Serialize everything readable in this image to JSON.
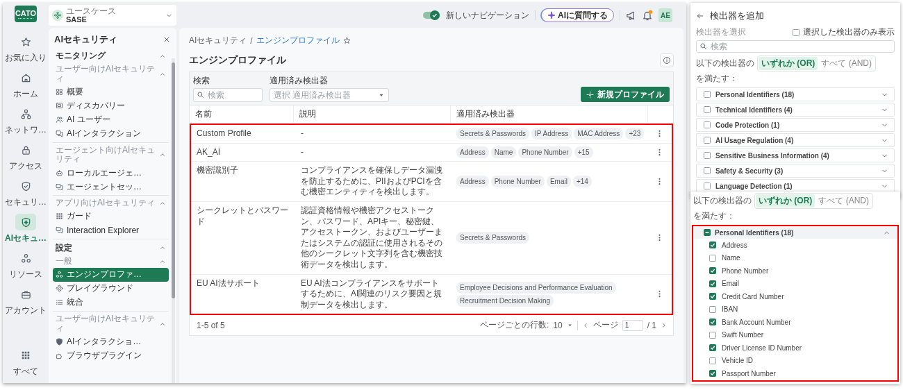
{
  "rail": {
    "logo": "CATO",
    "items": [
      {
        "label": "お気に入り",
        "selected": false
      },
      {
        "label": "ホーム",
        "selected": false
      },
      {
        "label": "ネットワ…",
        "selected": false
      },
      {
        "label": "アクセス",
        "selected": false
      },
      {
        "label": "セキュリ…",
        "selected": false
      },
      {
        "label": "AIセキュ…",
        "selected": true
      },
      {
        "label": "リソース",
        "selected": false
      },
      {
        "label": "アカウント",
        "selected": false
      }
    ],
    "all": "すべて"
  },
  "use_case": {
    "label": "ユースケース",
    "value": "SASE"
  },
  "topbar": {
    "nav_toggle": {
      "label": "新しいナビゲーション",
      "on": true
    },
    "ask_ai": "AIに質問する",
    "notification_badge": true,
    "avatar": "AE"
  },
  "sidebar": {
    "title": "AIセキュリティ",
    "sections": [
      {
        "title": "モニタリング",
        "expanded": true,
        "groups": [
          {
            "title": "ユーザー向けAIセキュリティ",
            "expanded": true,
            "items": [
              {
                "label": "概要",
                "selected": false
              },
              {
                "label": "ディスカバリー",
                "selected": false
              },
              {
                "label": "AI ユーザー",
                "selected": false
              },
              {
                "label": "AIインタラクション",
                "selected": false
              }
            ]
          },
          {
            "title": "エージェント向けAIセキュリティ",
            "expanded": true,
            "items": [
              {
                "label": "ローカルエージェ…",
                "selected": false
              },
              {
                "label": "エージェントセッ…",
                "selected": false
              }
            ]
          },
          {
            "title": "アプリ向けAIセキュリティ",
            "expanded": true,
            "items": [
              {
                "label": "ガード",
                "selected": false
              },
              {
                "label": "Interaction Explorer",
                "selected": false
              }
            ]
          }
        ]
      },
      {
        "title": "設定",
        "expanded": true,
        "groups": [
          {
            "title": "一般",
            "expanded": true,
            "items": [
              {
                "label": "エンジンプロファ…",
                "selected": true
              },
              {
                "label": "プレイグラウンド",
                "selected": false
              },
              {
                "label": "統合",
                "selected": false
              }
            ]
          },
          {
            "title": "ユーザー向けAIセキュリティ",
            "expanded": true,
            "items": [
              {
                "label": "AIインタラクショ…",
                "selected": false
              },
              {
                "label": "ブラウザプラグイン",
                "selected": false
              }
            ]
          }
        ]
      }
    ]
  },
  "breadcrumb": {
    "separator": "/",
    "items": [
      "AIセキュリティ",
      "エンジンプロファイル"
    ]
  },
  "page_title": "エンジンプロファイル",
  "filters": {
    "search": {
      "label": "検索",
      "placeholder": "検索"
    },
    "detectors": {
      "label": "適用済み検出器",
      "placeholder": "選択 適用済み検出器"
    },
    "new_button": "新規プロファイル"
  },
  "table": {
    "highlighted": true,
    "columns": [
      "名前",
      "説明",
      "適用済み検出器"
    ],
    "rows": [
      {
        "name": "Custom Profile",
        "description": "-",
        "detectors": [
          "Secrets & Passwords",
          "IP Address",
          "MAC Address",
          "+23"
        ]
      },
      {
        "name": "AK_AI",
        "description": "-",
        "detectors": [
          "Address",
          "Name",
          "Phone Number",
          "+15"
        ]
      },
      {
        "name": "機密識別子",
        "description": "コンプライアンスを確保しデータ漏洩を防止するために、PIIおよびPCIを含む機密エンティティを検出します。",
        "detectors": [
          "Address",
          "Phone Number",
          "Email",
          "+14"
        ]
      },
      {
        "name": "シークレットとパスワード",
        "description": "認証資格情報や機密アクセストークン、パスワード、APIキー、秘密鍵、アクセストークン、およびユーザーまたはシステムの認証に使用されるその他のシークレット文字列を含む機密技術データを検出します。",
        "detectors": [
          "Secrets & Passwords"
        ]
      },
      {
        "name": "EU AI法サポート",
        "description": "EU AI法コンプライアンスをサポートするために、AI関連のリスク要因と規制データを検出します。",
        "detectors": [
          "Employee Decisions and Performance Evaluation",
          "Recruitment Decision Making"
        ]
      }
    ]
  },
  "pagination": {
    "range": "1-5 of 5",
    "rows_per_page": {
      "label": "ページごとの行数:",
      "value": "10"
    },
    "page_label": "ページ",
    "page": "1",
    "total": "/ 1"
  },
  "add_detectors": {
    "title": "検出器を追加",
    "select_label": "検出器を選択",
    "show_selected_only": {
      "label": "選択した検出器のみ表示",
      "checked": false
    },
    "search": {
      "placeholder": "検索"
    },
    "match": {
      "prefix": "以下の検出器の",
      "options": [
        {
          "label": "いずれか (OR)",
          "selected": true
        },
        {
          "label": "すべて (AND)",
          "selected": false
        }
      ],
      "suffix": "を満たす："
    },
    "categories": [
      {
        "label": "Personal Identifiers (18)",
        "checked": false,
        "expanded": false
      },
      {
        "label": "Technical Identifiers (4)",
        "checked": false,
        "expanded": false
      },
      {
        "label": "Code Protection (1)",
        "checked": false,
        "expanded": false
      },
      {
        "label": "AI Usage Regulation (4)",
        "checked": false,
        "expanded": false
      },
      {
        "label": "Sensitive Business Information (4)",
        "checked": false,
        "expanded": false
      },
      {
        "label": "Safety & Security (3)",
        "checked": false,
        "expanded": false
      },
      {
        "label": "Language Detection (1)",
        "checked": false,
        "expanded": false
      }
    ]
  },
  "detector_detail": {
    "match": {
      "prefix": "以下の検出器の",
      "options": [
        {
          "label": "いずれか (OR)",
          "selected": true
        },
        {
          "label": "すべて (AND)",
          "selected": false
        }
      ],
      "suffix": "を満たす："
    },
    "highlighted": true,
    "group": {
      "label": "Personal Identifiers (18)",
      "partial": true,
      "expanded": true,
      "items": [
        {
          "label": "Address",
          "checked": true
        },
        {
          "label": "Name",
          "checked": false
        },
        {
          "label": "Phone Number",
          "checked": true
        },
        {
          "label": "Email",
          "checked": true
        },
        {
          "label": "Credit Card Number",
          "checked": true
        },
        {
          "label": "IBAN",
          "checked": false
        },
        {
          "label": "Bank Account Number",
          "checked": true
        },
        {
          "label": "Swift Number",
          "checked": false
        },
        {
          "label": "Driver License ID Number",
          "checked": true
        },
        {
          "label": "Vehicle ID",
          "checked": false
        },
        {
          "label": "Passport Number",
          "checked": true
        }
      ]
    }
  }
}
